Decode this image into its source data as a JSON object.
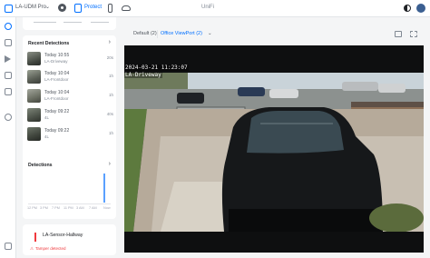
{
  "topbar": {
    "console_name": "LA-UDM Pro",
    "app_name": "Protect",
    "title": "UniFi"
  },
  "recent_detections": {
    "title": "Recent Detections",
    "items": [
      {
        "time": "Today 10:55",
        "camera": "LA-Driveway",
        "ago": "20s"
      },
      {
        "time": "Today 10:04",
        "camera": "LA-Frontdoor",
        "ago": "1h"
      },
      {
        "time": "Today 10:04",
        "camera": "LA-Frontdoor",
        "ago": "1h"
      },
      {
        "time": "Today 09:22",
        "camera": "4L",
        "ago": "40s"
      },
      {
        "time": "Today 09:22",
        "camera": "4L",
        "ago": "1h"
      }
    ]
  },
  "detections_chart": {
    "title": "Detections",
    "ticks": [
      "12 PM",
      "3 PM",
      "7 PM",
      "11 PM",
      "3 AM",
      "7 AM",
      "Now"
    ]
  },
  "sensor": {
    "name": "LA-Sensor-Hallway",
    "status": "Tamper detected"
  },
  "viewport": {
    "tab_default": "Default (2)",
    "tab_active": "Office ViewPort (2)",
    "tab_chevron": "⌄"
  },
  "video": {
    "timestamp": "2024-03-21  11:23:07",
    "camera_label": "LA-Driveway"
  },
  "colors": {
    "accent": "#006fff",
    "alert": "#f03a3e"
  }
}
